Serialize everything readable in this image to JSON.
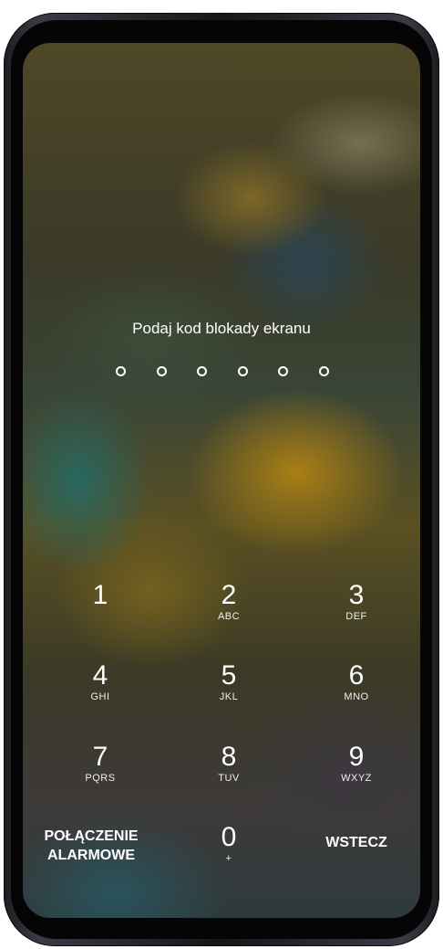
{
  "lockscreen": {
    "prompt": "Podaj kod blokady ekranu",
    "pin_length": 6
  },
  "keypad": {
    "keys": [
      {
        "digit": "1",
        "letters": ""
      },
      {
        "digit": "2",
        "letters": "ABC"
      },
      {
        "digit": "3",
        "letters": "DEF"
      },
      {
        "digit": "4",
        "letters": "GHI"
      },
      {
        "digit": "5",
        "letters": "JKL"
      },
      {
        "digit": "6",
        "letters": "MNO"
      },
      {
        "digit": "7",
        "letters": "PQRS"
      },
      {
        "digit": "8",
        "letters": "TUV"
      },
      {
        "digit": "9",
        "letters": "WXYZ"
      },
      {
        "digit": "0",
        "letters": "+"
      }
    ],
    "emergency_line1": "POŁĄCZENIE",
    "emergency_line2": "ALARMOWE",
    "back_label": "WSTECZ"
  },
  "colors": {
    "text": "#ffffff",
    "frame": "#1c1d22"
  }
}
